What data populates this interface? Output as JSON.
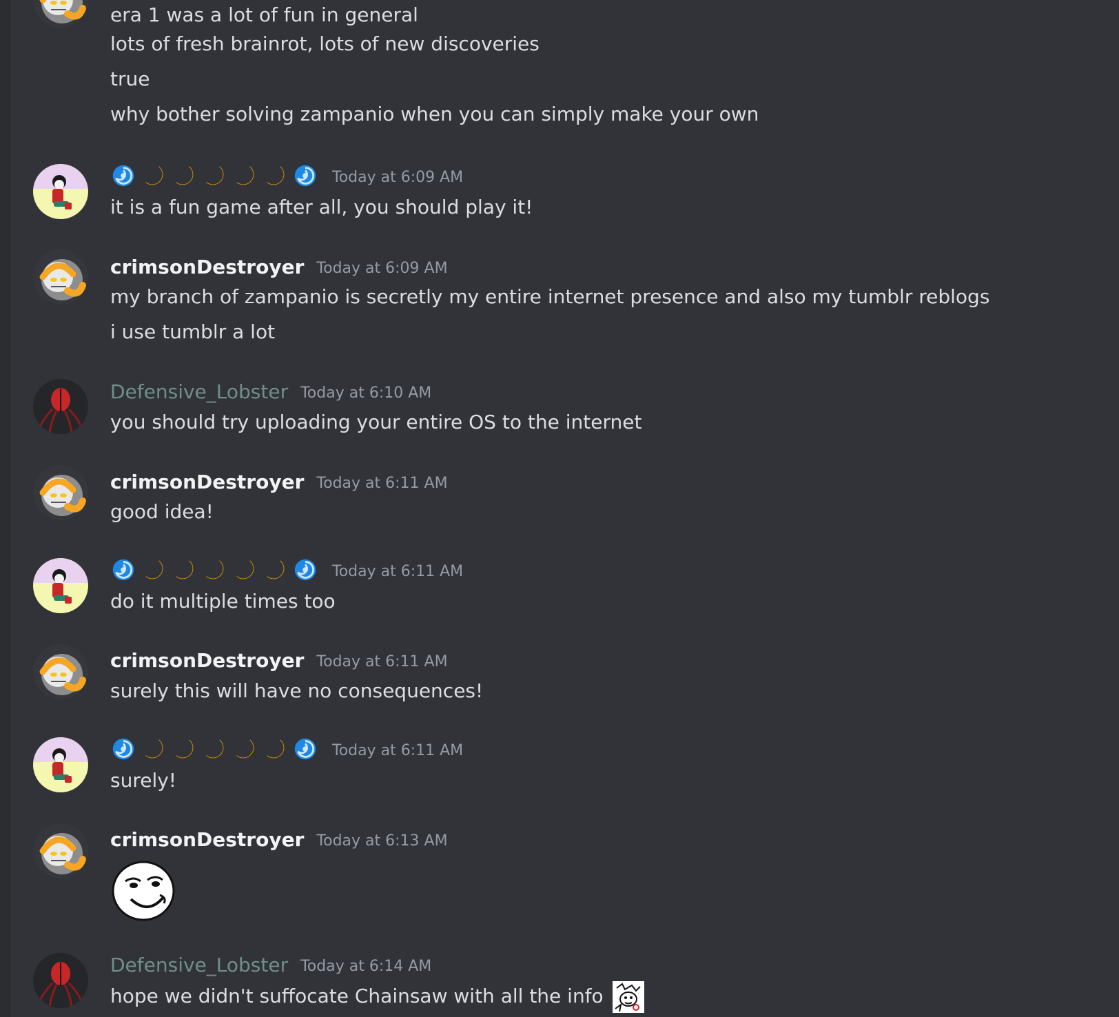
{
  "colors": {
    "background": "#323339",
    "text": "#dbdee1",
    "username": "#f2f3f5",
    "lobster_username": "#6f8f88",
    "timestamp": "#949ba4",
    "swirl_blue": "#1e88e5",
    "moon_yellow": "#f7b500"
  },
  "users": {
    "crimson": "crimsonDestroyer",
    "lobster": "Defensive_Lobster",
    "moon_user_icons": [
      "swirl-icon",
      "moon-icon",
      "moon-icon",
      "moon-icon",
      "moon-icon",
      "moon-icon",
      "swirl-icon"
    ]
  },
  "messages": {
    "top": {
      "lines": [
        "era 1 was a lot of fun in general",
        "lots of fresh brainrot, lots of new discoveries",
        "true",
        "why bother solving zampanio when you can simply make your own"
      ]
    },
    "m1": {
      "time": "Today at 6:09 AM",
      "lines": [
        "it is a fun game after all, you should play it!"
      ]
    },
    "m2": {
      "time": "Today at 6:09 AM",
      "lines": [
        "my branch of zampanio is secretly my entire internet presence and also my tumblr reblogs",
        "i use tumblr a lot"
      ]
    },
    "m3": {
      "time": "Today at 6:10 AM",
      "lines": [
        "you should try uploading your entire OS to the internet"
      ]
    },
    "m4": {
      "time": "Today at 6:11 AM",
      "lines": [
        "good idea!"
      ]
    },
    "m5": {
      "time": "Today at 6:11 AM",
      "lines": [
        "do it multiple times too"
      ]
    },
    "m6": {
      "time": "Today at 6:11 AM",
      "lines": [
        "surely this will have no consequences!"
      ]
    },
    "m7": {
      "time": "Today at 6:11 AM",
      "lines": [
        "surely!"
      ]
    },
    "m8": {
      "time": "Today at 6:13 AM",
      "emoji": "smug-face-emoji"
    },
    "m9": {
      "time": "Today at 6:14 AM",
      "lines": [
        "hope we didn't suffocate Chainsaw with all the info"
      ],
      "emoji": "sketch-emoji"
    }
  }
}
